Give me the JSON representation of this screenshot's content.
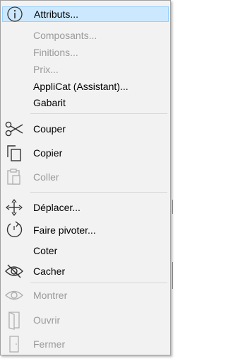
{
  "menu": {
    "items": [
      {
        "label": "Attributs...",
        "icon": "info-icon",
        "disabled": false,
        "highlighted": true
      },
      {
        "label": "Composants...",
        "icon": null,
        "disabled": true
      },
      {
        "label": "Finitions...",
        "icon": null,
        "disabled": true
      },
      {
        "label": "Prix...",
        "icon": null,
        "disabled": true
      },
      {
        "label": "AppliCat (Assistant)...",
        "icon": null,
        "disabled": false
      },
      {
        "label": "Gabarit",
        "icon": null,
        "disabled": false
      },
      {
        "label": "Couper",
        "icon": "scissors-icon",
        "disabled": false
      },
      {
        "label": "Copier",
        "icon": "copy-icon",
        "disabled": false
      },
      {
        "label": "Coller",
        "icon": "paste-icon",
        "disabled": true
      },
      {
        "label": "Déplacer...",
        "icon": "move-icon",
        "disabled": false
      },
      {
        "label": "Faire pivoter...",
        "icon": "rotate-icon",
        "disabled": false
      },
      {
        "label": "Coter",
        "icon": null,
        "disabled": false
      },
      {
        "label": "Cacher",
        "icon": "eye-hidden-icon",
        "disabled": false
      },
      {
        "label": "Montrer",
        "icon": "eye-icon",
        "disabled": true
      },
      {
        "label": "Ouvrir",
        "icon": "door-open-icon",
        "disabled": true
      },
      {
        "label": "Fermer",
        "icon": "door-closed-icon",
        "disabled": true
      }
    ]
  },
  "colors": {
    "highlight_bg": "#cce8ff",
    "highlight_border": "#99d1ff",
    "disabled_text": "#9a9a9a",
    "menu_bg": "#f2f2f2"
  }
}
